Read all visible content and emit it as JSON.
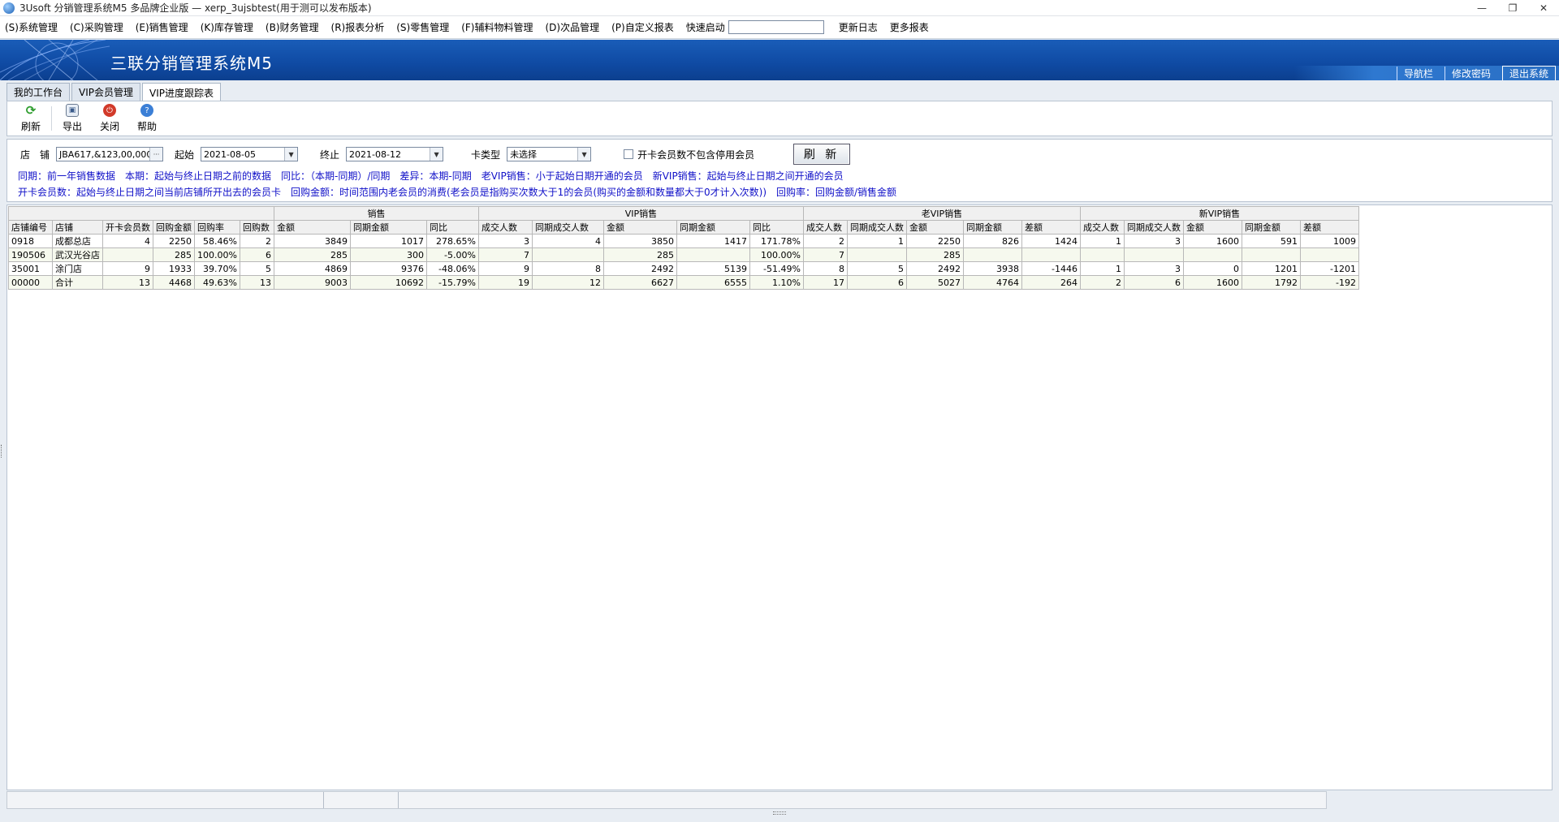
{
  "window": {
    "title": "3Usoft 分销管理系统M5 多品牌企业版 — xerp_3ujsbtest(用于测可以发布版本)",
    "controls": [
      "—",
      "❐",
      "✕"
    ]
  },
  "menu": {
    "items": [
      "(S)系统管理",
      "(C)采购管理",
      "(E)销售管理",
      "(K)库存管理",
      "(B)财务管理",
      "(R)报表分析",
      "(S)零售管理",
      "(F)辅料物料管理",
      "(D)次品管理",
      "(P)自定义报表"
    ],
    "quick_launch_label": "快速启动",
    "quick_launch_value": "",
    "update_log": "更新日志",
    "more_reports": "更多报表"
  },
  "banner": {
    "title": "三联分销管理系统M5",
    "links": [
      "导航栏",
      "修改密码",
      "退出系统"
    ]
  },
  "tabs": [
    "我的工作台",
    "VIP会员管理",
    "VIP进度跟踪表"
  ],
  "toolbar": {
    "refresh": "刷新",
    "export": "导出",
    "close": "关闭",
    "help": "帮助"
  },
  "filter": {
    "store_label": "店　铺",
    "store_value": "JBA617,&123,00,000",
    "start_label": "起始",
    "start_value": "2021-08-05",
    "end_label": "终止",
    "end_value": "2021-08-12",
    "card_type_label": "卡类型",
    "card_type_value": "未选择",
    "exclude_disabled_label": "开卡会员数不包含停用会员",
    "exclude_disabled_checked": false,
    "refresh_button": "刷 新"
  },
  "notes": {
    "line1": "同期：前一年销售数据　本期：起始与终止日期之前的数据　同比：（本期-同期）/同期　差异：本期-同期　老VIP销售：小于起始日期开通的会员　新VIP销售：起始与终止日期之间开通的会员",
    "line2": "开卡会员数：起始与终止日期之间当前店铺所开出去的会员卡　回购金额：时间范围内老会员的消费(老会员是指购买次数大于1的会员(购买的金额和数量都大于0才计入次数))　回购率：回购金额/销售金额"
  },
  "table": {
    "groups": [
      "销售",
      "VIP销售",
      "老VIP销售",
      "新VIP销售"
    ],
    "columns": [
      "店铺编号",
      "店铺",
      "开卡会员数",
      "回购金额",
      "回购率",
      "回购数",
      "金额",
      "同期金额",
      "同比",
      "成交人数",
      "同期成交人数",
      "金额",
      "同期金额",
      "同比",
      "成交人数",
      "同期成交人数",
      "金额",
      "同期金额",
      "差额",
      "成交人数",
      "同期成交人数",
      "金额",
      "同期金额",
      "差额"
    ],
    "rows": [
      [
        "0918",
        "成都总店",
        "4",
        "2250",
        "58.46%",
        "2",
        "3849",
        "1017",
        "278.65%",
        "3",
        "4",
        "3850",
        "1417",
        "171.78%",
        "2",
        "1",
        "2250",
        "826",
        "1424",
        "1",
        "3",
        "1600",
        "591",
        "1009"
      ],
      [
        "190506",
        "武汉光谷店",
        "",
        "285",
        "100.00%",
        "6",
        "285",
        "300",
        "-5.00%",
        "7",
        "",
        "285",
        "",
        "100.00%",
        "7",
        "",
        "285",
        "",
        "",
        "",
        "",
        "",
        "",
        ""
      ],
      [
        "35001",
        "涂门店",
        "9",
        "1933",
        "39.70%",
        "5",
        "4869",
        "9376",
        "-48.06%",
        "9",
        "8",
        "2492",
        "5139",
        "-51.49%",
        "8",
        "5",
        "2492",
        "3938",
        "-1446",
        "1",
        "3",
        "0",
        "1201",
        "-1201"
      ],
      [
        "00000",
        "合计",
        "13",
        "4468",
        "49.63%",
        "13",
        "9003",
        "10692",
        "-15.79%",
        "19",
        "12",
        "6627",
        "6555",
        "1.10%",
        "17",
        "6",
        "5027",
        "4764",
        "264",
        "2",
        "6",
        "1600",
        "1792",
        "-192"
      ]
    ]
  }
}
